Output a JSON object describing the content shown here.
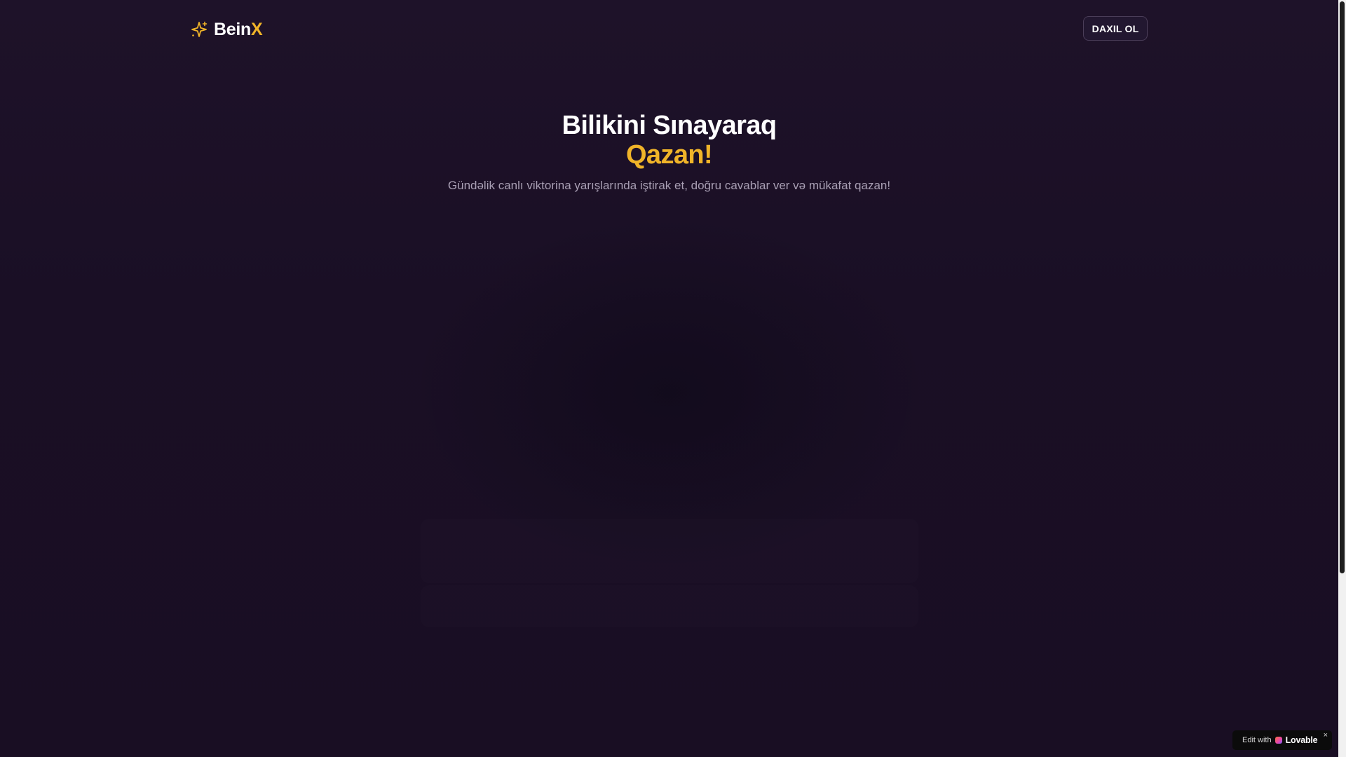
{
  "header": {
    "logo_main": "Bein",
    "logo_accent": "X",
    "logo_icon": "sparkles-icon",
    "login_label": "DAXIL OL"
  },
  "hero": {
    "title_line1": "Bilikini Sınayaraq",
    "title_line2": "Qazan!",
    "subtitle": "Gündəlik canlı viktorina yarışlarında iştirak et, doğru cavablar ver və mükafat qazan!"
  },
  "badge": {
    "edit_label": "Edit with",
    "brand": "Lovable",
    "close": "×"
  },
  "colors": {
    "background": "#1a0f24",
    "accent": "#f0b429",
    "subtitle_text": "#a99fb4"
  }
}
